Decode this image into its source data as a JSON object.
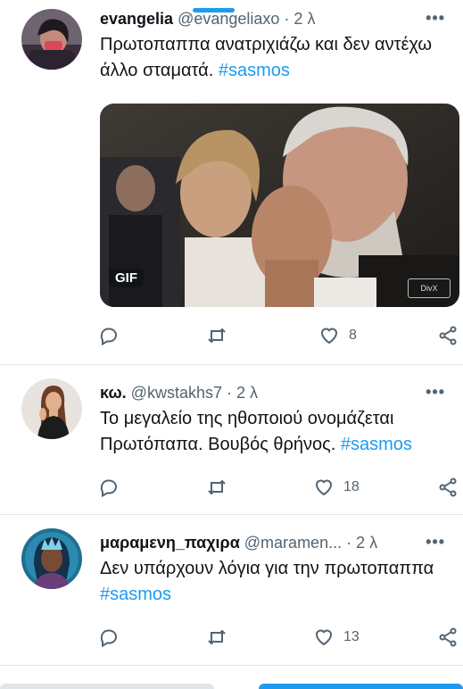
{
  "tweets": [
    {
      "name": "evangelia",
      "handle": "@evangeliaxo",
      "time": "· 2 λ",
      "more": "•••",
      "text": "Πρωτοπαππα ανατριχιάζω και δεν αντέχω άλλο σταματά.",
      "hashtag": "#sasmos",
      "media": {
        "badge": "GIF",
        "watermark": "DivX"
      },
      "likes": "8"
    },
    {
      "name": "κω.",
      "handle": "@kwstakhs7",
      "time": "· 2 λ",
      "more": "•••",
      "text": "Το μεγαλείο της ηθοποιού ονομάζεται Πρωτόπαπα. Βουβός θρήνος.",
      "hashtag": "#sasmos",
      "likes": "18"
    },
    {
      "name": "μαραμενη_παχιρα",
      "handle": "@maramen...",
      "time": "· 2 λ",
      "more": "•••",
      "text": "Δεν υπάρχουν λόγια για την πρωτοπαππα",
      "hashtag": "#sasmos",
      "likes": "13"
    }
  ],
  "icons": [
    "reply-icon",
    "retweet-icon",
    "like-icon",
    "share-icon"
  ],
  "colors": {
    "accent": "#1d9bf0",
    "secondary_text": "#536471",
    "primary_text": "#0f1419"
  }
}
